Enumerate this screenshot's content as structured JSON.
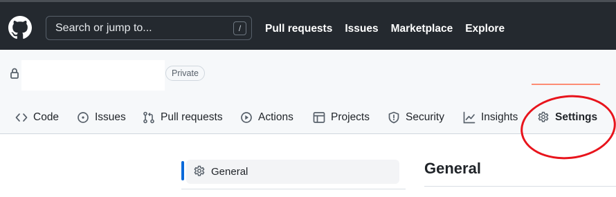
{
  "header": {
    "search_placeholder": "Search or jump to...",
    "search_shortcut": "/",
    "nav": [
      "Pull requests",
      "Issues",
      "Marketplace",
      "Explore"
    ]
  },
  "repo": {
    "visibility_badge": "Private"
  },
  "tabs": [
    {
      "label": "Code",
      "icon": "code-icon"
    },
    {
      "label": "Issues",
      "icon": "issue-opened-icon"
    },
    {
      "label": "Pull requests",
      "icon": "git-pull-request-icon"
    },
    {
      "label": "Actions",
      "icon": "play-icon"
    },
    {
      "label": "Projects",
      "icon": "table-icon"
    },
    {
      "label": "Security",
      "icon": "shield-icon"
    },
    {
      "label": "Insights",
      "icon": "graph-icon"
    },
    {
      "label": "Settings",
      "icon": "gear-icon",
      "selected": true
    }
  ],
  "colors": {
    "topbar": "#24292f",
    "selected_underline": "#fd8c73",
    "annotation": "#e8141c",
    "sidebar_accent": "#0969da"
  },
  "sidebar": {
    "items": [
      {
        "label": "General",
        "icon": "gear-icon",
        "selected": true
      }
    ]
  },
  "main": {
    "title": "General"
  }
}
